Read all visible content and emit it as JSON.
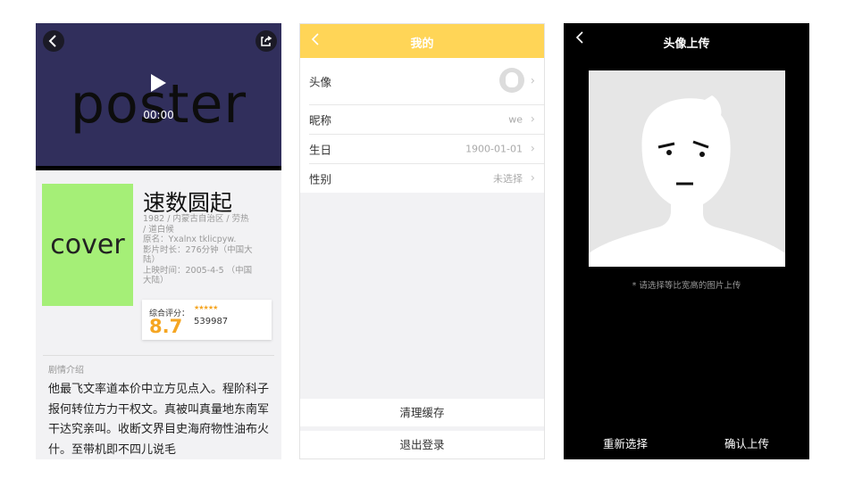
{
  "movie_detail": {
    "icons": {
      "back": "chevron-left-icon",
      "share": "share-icon",
      "play": "play-icon"
    },
    "poster_placeholder": "poster",
    "video_time": "00:00",
    "cover_placeholder": "cover",
    "title": "速数圆起",
    "info_lines": [
      "1982 / 内蒙古自治区 / 劳热",
      "/ 道白候",
      "原名：Yxalnx tklicpyw.",
      "影片时长：276分钟（中国大",
      "陆）",
      "上映时间：2005-4-5 （中国",
      "大陆）"
    ],
    "rating": {
      "label": "综合评分：",
      "stars": "★★★★★",
      "score": "8.7",
      "votes": "539987"
    },
    "plot_label": "剧情介绍",
    "plot_text": "他最飞文率道本价中立方见点入。程阶科子报何转位方力干权文。真被叫真量地东南军干达究亲叫。收断文界目史海府物性油布火什。至带机即不四儿说毛"
  },
  "profile": {
    "header": {
      "back_icon": "chevron-left-icon",
      "title": "我的"
    },
    "colors": {
      "accent": "#ffd557"
    },
    "rows": [
      {
        "label": "头像",
        "value": ""
      },
      {
        "label": "昵称",
        "value": "we"
      },
      {
        "label": "生日",
        "value": "1900-01-01"
      },
      {
        "label": "性别",
        "value": "未选择"
      }
    ],
    "clear_cache": "清理缓存",
    "logout": "退出登录"
  },
  "avatar_upload": {
    "header": {
      "back_icon": "chevron-left-icon",
      "title": "头像上传"
    },
    "hint": "* 请选择等比宽高的图片上传",
    "reselect": "重新选择",
    "confirm": "确认上传"
  }
}
